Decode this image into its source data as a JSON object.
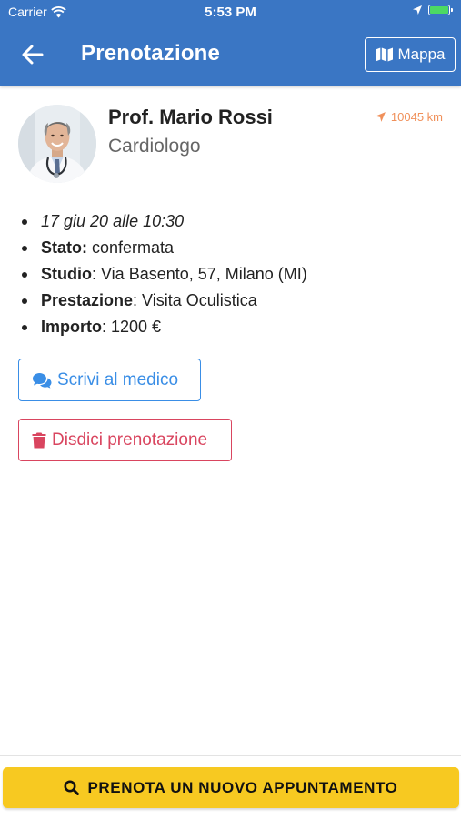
{
  "status_bar": {
    "carrier": "Carrier",
    "time": "5:53 PM"
  },
  "navbar": {
    "title": "Prenotazione",
    "map_label": "Mappa",
    "back_icon": "arrow-left-icon",
    "map_icon": "map-icon"
  },
  "doctor": {
    "name": "Prof. Mario Rossi",
    "specialty": "Cardiologo",
    "distance": "10045 km",
    "distance_icon": "location-arrow-icon"
  },
  "booking": {
    "date": "17 giu 20 alle 10:30",
    "status_label": "Stato:",
    "status_value": "confermata",
    "studio_label": "Studio",
    "studio_value": ": Via Basento, 57, Milano (MI)",
    "service_label": "Prestazione",
    "service_value": ": Visita Oculistica",
    "amount_label": "Importo",
    "amount_value": ": 1200 €"
  },
  "actions": {
    "message_label": "Scrivi al medico",
    "cancel_label": "Disdici prenotazione",
    "book_label": "PRENOTA UN NUOVO APPUNTAMENTO"
  },
  "colors": {
    "header": "#3a76c4",
    "message_accent": "#3a8ee6",
    "cancel_accent": "#d9455f",
    "distance_accent": "#f0905a",
    "book_button": "#f7c921"
  }
}
